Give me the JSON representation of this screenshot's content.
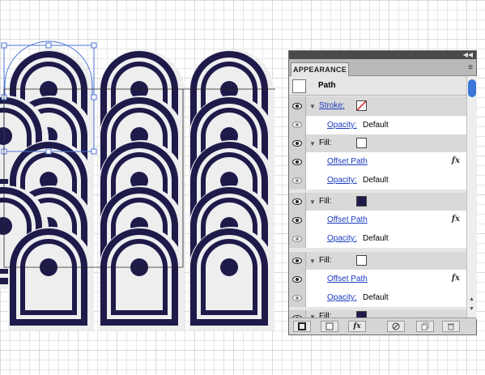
{
  "panel": {
    "tab_label": "APPEARANCE",
    "title_dbl_arrow": "◀◀",
    "menu_icon": "≡",
    "object_label": "Path",
    "rows": {
      "stroke_label": "Stroke:",
      "opacity1_label": "Opacity:",
      "opacity1_value": "Default",
      "fill1_label": "Fill:",
      "offset1_label": "Offset Path",
      "opacity2_label": "Opacity:",
      "opacity2_value": "Default",
      "fill2_label": "Fill:",
      "offset2_label": "Offset Path",
      "opacity3_label": "Opacity:",
      "opacity3_value": "Default",
      "fill3_label": "Fill:",
      "offset3_label": "Offset Path",
      "opacity4_label": "Opacity:",
      "opacity4_value": "Default",
      "fill4_label": "Fill:"
    },
    "fx_label": "fx",
    "colors": {
      "navy": "#1e1b4a",
      "link": "#1b3bbf",
      "shape_fill": "#eeeeef"
    }
  }
}
